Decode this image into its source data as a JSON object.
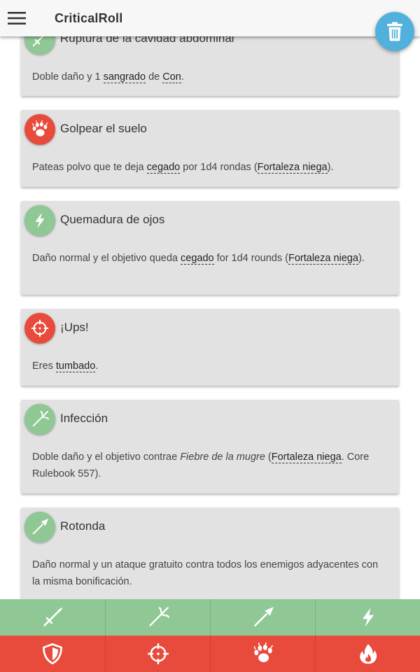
{
  "app": {
    "title": "CriticalRoll"
  },
  "colors": {
    "confirm": "#8fc894",
    "fumble": "#e84a3c",
    "fab": "#52b1dc",
    "card": "#e2e2e2"
  },
  "cards": [
    {
      "icon": "sword-icon",
      "tone": "green",
      "title": "Ruptura de la cavidad abdominal",
      "body": [
        {
          "t": "Doble daño y 1 "
        },
        {
          "t": "sangrado",
          "u": true
        },
        {
          "t": " de "
        },
        {
          "t": "Con",
          "u": true
        },
        {
          "t": "."
        }
      ]
    },
    {
      "icon": "paw-icon",
      "tone": "red",
      "title": "Golpear el suelo",
      "body": [
        {
          "t": "Pateas polvo que te deja "
        },
        {
          "t": "cegado",
          "u": true
        },
        {
          "t": " por 1d4 rondas ("
        },
        {
          "t": "Fortaleza niega",
          "u": true
        },
        {
          "t": ")."
        }
      ]
    },
    {
      "icon": "lightning-icon",
      "tone": "green",
      "title": "Quemadura de ojos",
      "body": [
        {
          "t": "Daño normal y el objetivo queda "
        },
        {
          "t": "cegado",
          "u": true
        },
        {
          "t": " for 1d4 rounds ("
        },
        {
          "t": "Fortaleza niega",
          "u": true
        },
        {
          "t": ")."
        }
      ]
    },
    {
      "icon": "crosshair-icon",
      "tone": "red",
      "title": "¡Ups!",
      "body": [
        {
          "t": "Eres "
        },
        {
          "t": "tumbado",
          "u": true
        },
        {
          "t": "."
        }
      ]
    },
    {
      "icon": "trident-icon",
      "tone": "green",
      "title": "Infección",
      "body": [
        {
          "t": "Doble daño y el objetivo contrae "
        },
        {
          "t": "Fiebre de la mugre",
          "i": true
        },
        {
          "t": " ("
        },
        {
          "t": "Fortaleza niega",
          "u": true
        },
        {
          "t": ". Core Rulebook 557)."
        }
      ]
    },
    {
      "icon": "spear-icon",
      "tone": "green",
      "title": "Rotonda",
      "body": [
        {
          "t": "Daño normal y un ataque gratuito contra todos los enemigos adyacentes con la misma bonificación."
        }
      ]
    }
  ],
  "confirm_bar": [
    "sword-icon",
    "trident-icon",
    "spear-icon",
    "lightning-icon"
  ],
  "fumble_bar": [
    "shield-icon",
    "crosshair-icon",
    "paw-icon",
    "fire-icon"
  ]
}
